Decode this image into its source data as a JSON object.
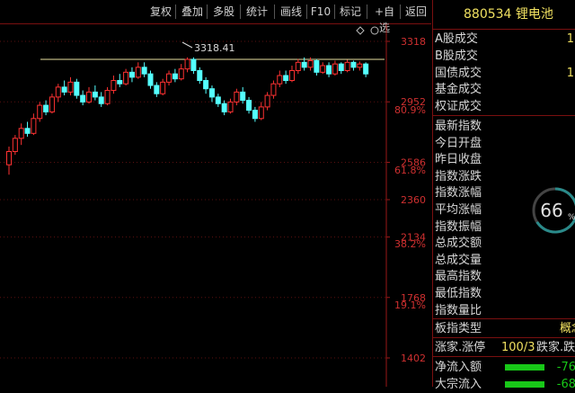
{
  "toolbar": {
    "buttons": [
      {
        "label": "复权"
      },
      {
        "label": "叠加"
      },
      {
        "label": "多股"
      },
      {
        "label": "统计"
      },
      {
        "label": "画线"
      },
      {
        "label": "F10"
      },
      {
        "label": "标记"
      },
      {
        "label": "+自选"
      },
      {
        "label": "返回"
      }
    ]
  },
  "sidebar": {
    "title": "880534 锂电池",
    "volume_rows": [
      {
        "label": "A股成交",
        "value": "1"
      },
      {
        "label": "B股成交",
        "value": ""
      },
      {
        "label": "国债成交",
        "value": "1"
      },
      {
        "label": "基金成交",
        "value": ""
      },
      {
        "label": "权证成交",
        "value": ""
      }
    ],
    "index_rows": [
      {
        "label": "最新指数"
      },
      {
        "label": "今日开盘"
      },
      {
        "label": "昨日收盘"
      },
      {
        "label": "指数涨跌"
      },
      {
        "label": "指数涨幅"
      },
      {
        "label": "平均涨幅"
      },
      {
        "label": "指数振幅"
      },
      {
        "label": "总成交额"
      },
      {
        "label": "总成交量"
      },
      {
        "label": "最高指数"
      },
      {
        "label": "最低指数"
      },
      {
        "label": "指数量比"
      }
    ],
    "gauge": {
      "value": "66",
      "unit": "%"
    },
    "plate_type": {
      "label": "板指类型",
      "value": "概念"
    },
    "limit_row": {
      "label": "涨家.涨停",
      "value": "100/3",
      "label2": "跌家.跌"
    },
    "flow_rows": [
      {
        "label": "净流入额",
        "value": "-76"
      },
      {
        "label": "大宗流入",
        "value": "-68"
      }
    ]
  },
  "chart_data": {
    "type": "candlestick",
    "price_ticks": [
      "3318",
      "2952",
      "2586",
      "2360",
      "2134",
      "1768",
      "1402"
    ],
    "pct_ticks": [
      "80.9%",
      "61.8%",
      "38.2%",
      "19.1%"
    ],
    "max_label": "3318.41",
    "ref_line_value": 3318,
    "candles": [
      [
        2680,
        2760,
        2620,
        2790
      ],
      [
        2760,
        2840,
        2740,
        2860
      ],
      [
        2840,
        2900,
        2800,
        2930
      ],
      [
        2900,
        2870,
        2850,
        2940
      ],
      [
        2870,
        2960,
        2860,
        2990
      ],
      [
        2960,
        3040,
        2940,
        3060
      ],
      [
        3040,
        3000,
        2980,
        3070
      ],
      [
        3000,
        3090,
        2990,
        3110
      ],
      [
        3090,
        3150,
        3060,
        3170
      ],
      [
        3150,
        3120,
        3100,
        3190
      ],
      [
        3120,
        3180,
        3100,
        3210
      ],
      [
        3180,
        3100,
        3080,
        3200
      ],
      [
        3100,
        3060,
        3040,
        3130
      ],
      [
        3060,
        3120,
        3050,
        3150
      ],
      [
        3120,
        3090,
        3070,
        3160
      ],
      [
        3090,
        3050,
        3030,
        3120
      ],
      [
        3050,
        3130,
        3040,
        3150
      ],
      [
        3130,
        3190,
        3110,
        3220
      ],
      [
        3190,
        3170,
        3150,
        3230
      ],
      [
        3170,
        3240,
        3160,
        3260
      ],
      [
        3240,
        3210,
        3180,
        3270
      ],
      [
        3210,
        3270,
        3200,
        3300
      ],
      [
        3270,
        3230,
        3210,
        3300
      ],
      [
        3230,
        3160,
        3140,
        3250
      ],
      [
        3160,
        3110,
        3090,
        3180
      ],
      [
        3110,
        3180,
        3100,
        3200
      ],
      [
        3180,
        3230,
        3160,
        3250
      ],
      [
        3230,
        3200,
        3180,
        3260
      ],
      [
        3200,
        3260,
        3190,
        3290
      ],
      [
        3260,
        3318,
        3240,
        3330
      ],
      [
        3318,
        3250,
        3230,
        3330
      ],
      [
        3250,
        3190,
        3170,
        3270
      ],
      [
        3190,
        3140,
        3110,
        3210
      ],
      [
        3140,
        3090,
        3060,
        3160
      ],
      [
        3090,
        3050,
        3030,
        3110
      ],
      [
        3050,
        3000,
        2980,
        3070
      ],
      [
        3000,
        3060,
        2990,
        3080
      ],
      [
        3060,
        3120,
        3040,
        3140
      ],
      [
        3120,
        3070,
        3050,
        3150
      ],
      [
        3070,
        3010,
        2990,
        3090
      ],
      [
        3010,
        2960,
        2940,
        3030
      ],
      [
        2960,
        3030,
        2950,
        3060
      ],
      [
        3030,
        3100,
        3010,
        3120
      ],
      [
        3100,
        3170,
        3080,
        3190
      ],
      [
        3170,
        3220,
        3150,
        3250
      ],
      [
        3220,
        3190,
        3170,
        3250
      ],
      [
        3190,
        3250,
        3180,
        3280
      ],
      [
        3250,
        3300,
        3230,
        3320
      ],
      [
        3300,
        3270,
        3250,
        3330
      ],
      [
        3270,
        3310,
        3250,
        3330
      ],
      [
        3310,
        3240,
        3220,
        3320
      ],
      [
        3240,
        3280,
        3230,
        3300
      ],
      [
        3280,
        3230,
        3210,
        3300
      ],
      [
        3230,
        3290,
        3220,
        3310
      ],
      [
        3290,
        3250,
        3230,
        3300
      ],
      [
        3250,
        3300,
        3240,
        3315
      ],
      [
        3300,
        3270,
        3250,
        3310
      ],
      [
        3270,
        3290,
        3250,
        3305
      ],
      [
        3290,
        3230,
        3210,
        3300
      ]
    ]
  }
}
